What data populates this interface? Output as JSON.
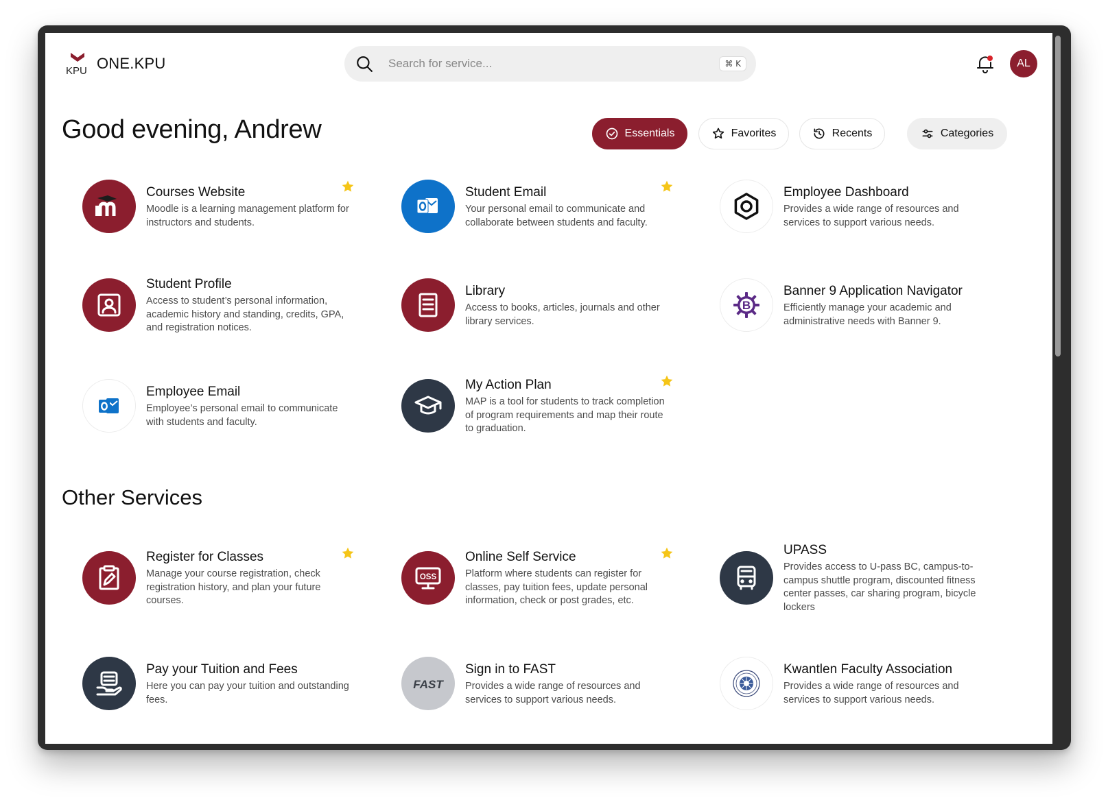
{
  "app": {
    "brand_mark": "KPU",
    "name": "ONE.KPU"
  },
  "search": {
    "placeholder": "Search for service...",
    "shortcut": "⌘ K"
  },
  "user": {
    "initials": "AL"
  },
  "greeting": "Good evening, Andrew",
  "filters": [
    {
      "label": "Essentials",
      "icon": "check-circle-icon",
      "active": true
    },
    {
      "label": "Favorites",
      "icon": "star-outline-icon",
      "active": false
    },
    {
      "label": "Recents",
      "icon": "history-icon",
      "active": false
    },
    {
      "label": "Categories",
      "icon": "sliders-icon",
      "active": false
    }
  ],
  "essentials": [
    {
      "title": "Courses Website",
      "desc": "Moodle is a learning management platform for instructors and students.",
      "icon": "moodle-icon",
      "starred": true
    },
    {
      "title": "Student Email",
      "desc": "Your personal email to communicate and collaborate between students and faculty.",
      "icon": "outlook-icon",
      "starred": true
    },
    {
      "title": "Employee Dashboard",
      "desc": "Provides a wide range of resources and services to support various needs.",
      "icon": "hexagon-icon",
      "starred": false
    },
    {
      "title": "Student Profile",
      "desc": "Access to student’s personal information, academic history and standing, credits, GPA, and registration notices.",
      "icon": "profile-icon",
      "starred": false
    },
    {
      "title": "Library",
      "desc": "Access to books, articles, journals and other library services.",
      "icon": "document-icon",
      "starred": false
    },
    {
      "title": "Banner 9 Application Navigator",
      "desc": "Efficiently manage your academic and administrative needs with Banner 9.",
      "icon": "banner-icon",
      "starred": false
    },
    {
      "title": "Employee Email",
      "desc": "Employee’s personal email to communicate with students and faculty.",
      "icon": "outlook-icon",
      "starred": false
    },
    {
      "title": "My Action Plan",
      "desc": "MAP is a tool for students to track completion of program requirements and map their route to graduation.",
      "icon": "graduation-cap-icon",
      "starred": true
    }
  ],
  "other_title": "Other Services",
  "other": [
    {
      "title": "Register for Classes",
      "desc": "Manage your course registration, check registration history, and plan your future courses.",
      "icon": "clipboard-icon",
      "starred": true
    },
    {
      "title": "Online Self Service",
      "desc": "Platform where students can register for classes, pay tuition fees, update personal information, check or post grades, etc.",
      "icon": "oss-monitor-icon",
      "icon_text": "OSS",
      "starred": true
    },
    {
      "title": "UPASS",
      "desc": "Provides access to U-pass BC, campus-to-campus shuttle program, discounted fitness center passes, car sharing program, bicycle lockers",
      "icon": "bus-icon",
      "starred": false
    },
    {
      "title": "Pay your Tuition and Fees",
      "desc": "Here you can pay your tuition and outstanding fees.",
      "icon": "payment-icon",
      "starred": false
    },
    {
      "title": "Sign in to FAST",
      "desc": "Provides a wide range of resources and services to support various needs.",
      "icon": "fast-icon",
      "icon_text": "FAST",
      "starred": false
    },
    {
      "title": "Kwantlen Faculty Association",
      "desc": "Provides a wide range of resources and services to support various needs.",
      "icon": "kfa-seal-icon",
      "starred": false
    }
  ],
  "colors": {
    "brand": "#8b1e2e",
    "outlook_blue": "#0e72c9",
    "dark_icon": "#2e3846",
    "star": "#f5c518",
    "banner_purple": "#5b2a86"
  }
}
